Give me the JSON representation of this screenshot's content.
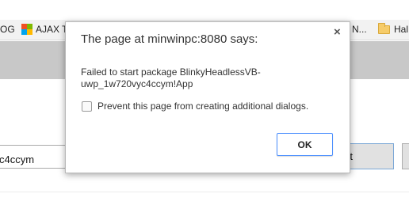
{
  "bookmarks": {
    "item_dg": "OG",
    "item_ajax": "AJAX T",
    "item_n": "N...",
    "item_hal": "Hal"
  },
  "page": {
    "package_value": "c4ccym",
    "start_button_label": "rt"
  },
  "dialog": {
    "title": "The page at minwinpc:8080 says:",
    "close_glyph": "×",
    "message_line1": "Failed to start package BlinkyHeadlessVB-",
    "message_line2": "uwp_1w720vyc4ccym!App",
    "checkbox_label": "Prevent this page from creating additional dialogs.",
    "ok_label": "OK"
  }
}
